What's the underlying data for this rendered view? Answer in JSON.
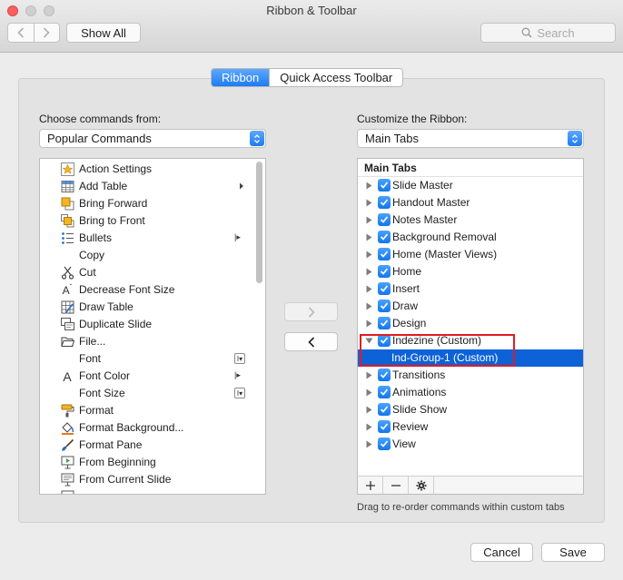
{
  "window": {
    "title": "Ribbon & Toolbar"
  },
  "toolbar": {
    "show_all_label": "Show All",
    "search_placeholder": "Search"
  },
  "tabs": [
    {
      "label": "Ribbon",
      "active": true
    },
    {
      "label": "Quick Access Toolbar",
      "active": false
    }
  ],
  "left": {
    "label": "Choose commands from:",
    "selected": "Popular Commands",
    "commands": [
      {
        "label": "Action Settings",
        "icon": "star-icon",
        "suffix": "none"
      },
      {
        "label": "Add Table",
        "icon": "table-icon",
        "suffix": "submenu"
      },
      {
        "label": "Bring Forward",
        "icon": "bring-forward-icon",
        "suffix": "none"
      },
      {
        "label": "Bring to Front",
        "icon": "bring-to-front-icon",
        "suffix": "none"
      },
      {
        "label": "Bullets",
        "icon": "bullets-icon",
        "suffix": "split"
      },
      {
        "label": "Copy",
        "icon": "copy-icon",
        "suffix": "none"
      },
      {
        "label": "Cut",
        "icon": "scissors-icon",
        "suffix": "none"
      },
      {
        "label": "Decrease Font Size",
        "icon": "decrease-font-icon",
        "suffix": "none"
      },
      {
        "label": "Draw Table",
        "icon": "draw-table-icon",
        "suffix": "none"
      },
      {
        "label": "Duplicate Slide",
        "icon": "duplicate-slide-icon",
        "suffix": "none"
      },
      {
        "label": "File...",
        "icon": "folder-icon",
        "suffix": "none"
      },
      {
        "label": "Font",
        "icon": "none",
        "suffix": "combo"
      },
      {
        "label": "Font Color",
        "icon": "font-color-icon",
        "suffix": "split"
      },
      {
        "label": "Font Size",
        "icon": "none",
        "suffix": "combo"
      },
      {
        "label": "Format",
        "icon": "format-painter-icon",
        "suffix": "none"
      },
      {
        "label": "Format Background...",
        "icon": "paint-bucket-icon",
        "suffix": "none"
      },
      {
        "label": "Format Pane",
        "icon": "brush-icon",
        "suffix": "none"
      },
      {
        "label": "From Beginning",
        "icon": "slideshow-start-icon",
        "suffix": "none"
      },
      {
        "label": "From Current Slide",
        "icon": "slideshow-current-icon",
        "suffix": "none"
      }
    ]
  },
  "right": {
    "label": "Customize the Ribbon:",
    "selected": "Main Tabs",
    "header": "Main Tabs",
    "items": [
      {
        "label": "Slide Master",
        "expanded": false,
        "checked": true,
        "selected": false
      },
      {
        "label": "Handout Master",
        "expanded": false,
        "checked": true,
        "selected": false
      },
      {
        "label": "Notes Master",
        "expanded": false,
        "checked": true,
        "selected": false
      },
      {
        "label": "Background Removal",
        "expanded": false,
        "checked": true,
        "selected": false
      },
      {
        "label": "Home (Master Views)",
        "expanded": false,
        "checked": true,
        "selected": false
      },
      {
        "label": "Home",
        "expanded": false,
        "checked": true,
        "selected": false
      },
      {
        "label": "Insert",
        "expanded": false,
        "checked": true,
        "selected": false
      },
      {
        "label": "Draw",
        "expanded": false,
        "checked": true,
        "selected": false
      },
      {
        "label": "Design",
        "expanded": false,
        "checked": true,
        "selected": false
      },
      {
        "label": "Indezine (Custom)",
        "expanded": true,
        "checked": true,
        "selected": false
      },
      {
        "label": "Ind-Group-1 (Custom)",
        "child": true,
        "selected": true
      },
      {
        "label": "Transitions",
        "expanded": false,
        "checked": true,
        "selected": false
      },
      {
        "label": "Animations",
        "expanded": false,
        "checked": true,
        "selected": false
      },
      {
        "label": "Slide Show",
        "expanded": false,
        "checked": true,
        "selected": false
      },
      {
        "label": "Review",
        "expanded": false,
        "checked": true,
        "selected": false
      },
      {
        "label": "View",
        "expanded": false,
        "checked": true,
        "selected": false
      }
    ],
    "hint": "Drag to re-order commands within custom tabs"
  },
  "footer": {
    "cancel_label": "Cancel",
    "save_label": "Save"
  },
  "colors": {
    "accent": "#1d7cf2",
    "selection": "#0d62d8",
    "highlight_box": "#e11b22"
  }
}
